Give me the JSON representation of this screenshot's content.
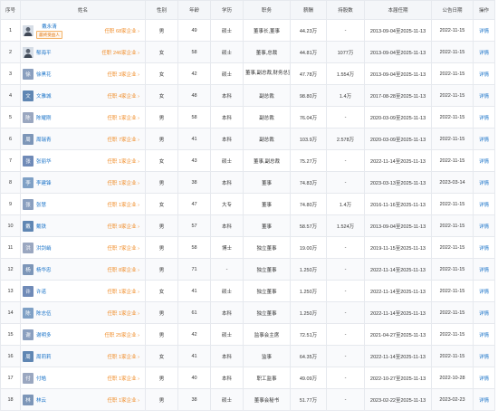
{
  "table": {
    "columns": [
      "序号",
      "姓名",
      "性别",
      "年龄",
      "学历",
      "职务",
      "薪酬",
      "持股数",
      "本届任期",
      "公告日期",
      "操作"
    ],
    "rows": [
      {
        "no": "1",
        "avatar": "photo",
        "name": "戴永清",
        "badge": "最终受益人",
        "companies": "任职 68家企业 ›",
        "gender": "男",
        "age": "49",
        "edu": "硕士",
        "title": "董事长,董事",
        "salary": "44.23万",
        "shares": "-",
        "term": "2013-09-04至2025-11-13",
        "date": "2022-11-15",
        "action": "详情"
      },
      {
        "no": "2",
        "avatar": "photo",
        "name": "郁海平",
        "badge": "",
        "companies": "任职 246家企业 ›",
        "gender": "女",
        "age": "58",
        "edu": "硕士",
        "title": "董事,总裁",
        "salary": "44.81万",
        "shares": "1077万",
        "term": "2013-09-04至2025-11-13",
        "date": "2022-11-15",
        "action": "详情"
      },
      {
        "no": "3",
        "avatar": "徐",
        "name": "徐黑花",
        "badge": "",
        "companies": "任职 3家企业 ›",
        "gender": "女",
        "age": "42",
        "edu": "硕士",
        "title": "董事,副总裁,财务总监",
        "salary": "47.78万",
        "shares": "1.554万",
        "term": "2013-09-04至2025-11-13",
        "date": "2022-11-15",
        "action": "详情"
      },
      {
        "no": "4",
        "avatar": "文",
        "name": "文雅城",
        "badge": "",
        "companies": "任职 4家企业 ›",
        "gender": "女",
        "age": "48",
        "edu": "本科",
        "title": "副总裁",
        "salary": "98.80万",
        "shares": "1.4万",
        "term": "2017-08-28至2025-11-13",
        "date": "2022-11-15",
        "action": "详情"
      },
      {
        "no": "5",
        "avatar": "陈",
        "name": "陈耀刚",
        "badge": "",
        "companies": "任职 1家企业 ›",
        "gender": "男",
        "age": "58",
        "edu": "本科",
        "title": "副总裁",
        "salary": "76.04万",
        "shares": "-",
        "term": "2020-03-09至2025-11-13",
        "date": "2022-11-15",
        "action": "详情"
      },
      {
        "no": "6",
        "avatar": "周",
        "name": "周瑞青",
        "badge": "",
        "companies": "任职 7家企业 ›",
        "gender": "男",
        "age": "41",
        "edu": "本科",
        "title": "副总裁",
        "salary": "103.9万",
        "shares": "2.578万",
        "term": "2020-03-09至2025-11-13",
        "date": "2022-11-15",
        "action": "详情"
      },
      {
        "no": "7",
        "avatar": "张",
        "name": "张丽华",
        "badge": "",
        "companies": "任职 1家企业 ›",
        "gender": "女",
        "age": "43",
        "edu": "硕士",
        "title": "董事,副总裁",
        "salary": "75.27万",
        "shares": "-",
        "term": "2022-11-14至2025-11-13",
        "date": "2022-11-15",
        "action": "详情"
      },
      {
        "no": "8",
        "avatar": "李",
        "name": "李建锋",
        "badge": "",
        "companies": "任职 1家企业 ›",
        "gender": "男",
        "age": "38",
        "edu": "本科",
        "title": "董事",
        "salary": "74.83万",
        "shares": "-",
        "term": "2023-03-13至2025-11-13",
        "date": "2023-03-14",
        "action": "详情"
      },
      {
        "no": "9",
        "avatar": "张",
        "name": "张慧",
        "badge": "",
        "companies": "任职 1家企业 ›",
        "gender": "女",
        "age": "47",
        "edu": "大专",
        "title": "董事",
        "salary": "74.80万",
        "shares": "1.4万",
        "term": "2016-11-16至2025-11-13",
        "date": "2022-11-15",
        "action": "详情"
      },
      {
        "no": "10",
        "avatar": "戴",
        "name": "戴铁",
        "badge": "",
        "companies": "任职 9家企业 ›",
        "gender": "男",
        "age": "57",
        "edu": "本科",
        "title": "董事",
        "salary": "58.57万",
        "shares": "1.524万",
        "term": "2013-09-04至2025-11-13",
        "date": "2022-11-15",
        "action": "详情"
      },
      {
        "no": "11",
        "avatar": "洪",
        "name": "洪剑峭",
        "badge": "",
        "companies": "任职 7家企业 ›",
        "gender": "男",
        "age": "58",
        "edu": "博士",
        "title": "独立董事",
        "salary": "19.00万",
        "shares": "-",
        "term": "2019-11-15至2025-11-13",
        "date": "2022-11-15",
        "action": "详情"
      },
      {
        "no": "12",
        "avatar": "杨",
        "name": "杨华忠",
        "badge": "",
        "companies": "任职 8家企业 ›",
        "gender": "男",
        "age": "71",
        "edu": "-",
        "title": "独立董事",
        "salary": "1.250万",
        "shares": "-",
        "term": "2022-11-14至2025-11-13",
        "date": "2022-11-15",
        "action": "详情"
      },
      {
        "no": "13",
        "avatar": "许",
        "name": "许诺",
        "badge": "",
        "companies": "任职 1家企业 ›",
        "gender": "女",
        "age": "41",
        "edu": "硕士",
        "title": "独立董事",
        "salary": "1.250万",
        "shares": "-",
        "term": "2022-11-14至2025-11-13",
        "date": "2022-11-15",
        "action": "详情"
      },
      {
        "no": "14",
        "avatar": "陈",
        "name": "陈志伍",
        "badge": "",
        "companies": "任职 1家企业 ›",
        "gender": "男",
        "age": "61",
        "edu": "本科",
        "title": "独立董事",
        "salary": "1.250万",
        "shares": "-",
        "term": "2022-11-14至2025-11-13",
        "date": "2022-11-15",
        "action": "详情"
      },
      {
        "no": "15",
        "avatar": "谢",
        "name": "谢明多",
        "badge": "",
        "companies": "任职 25家企业 ›",
        "gender": "男",
        "age": "42",
        "edu": "硕士",
        "title": "监事会主席",
        "salary": "72.51万",
        "shares": "-",
        "term": "2021-04-27至2025-11-13",
        "date": "2022-11-15",
        "action": "详情"
      },
      {
        "no": "16",
        "avatar": "周",
        "name": "周莉莉",
        "badge": "",
        "companies": "任职 1家企业 ›",
        "gender": "女",
        "age": "41",
        "edu": "本科",
        "title": "监事",
        "salary": "64.35万",
        "shares": "-",
        "term": "2022-11-14至2025-11-13",
        "date": "2022-11-15",
        "action": "详情"
      },
      {
        "no": "17",
        "avatar": "付",
        "name": "付皓",
        "badge": "",
        "companies": "任职 1家企业 ›",
        "gender": "男",
        "age": "40",
        "edu": "本科",
        "title": "职工监事",
        "salary": "49.09万",
        "shares": "-",
        "term": "2022-10-27至2025-11-13",
        "date": "2022-10-28",
        "action": "详情"
      },
      {
        "no": "18",
        "avatar": "林",
        "name": "林云",
        "badge": "",
        "companies": "任职 1家企业 ›",
        "gender": "男",
        "age": "38",
        "edu": "硕士",
        "title": "董事会秘书",
        "salary": "51.77万",
        "shares": "-",
        "term": "2023-02-22至2025-11-13",
        "date": "2023-02-23",
        "action": "详情"
      }
    ]
  },
  "colors": {
    "avatar_palette": [
      "#6f8ab7",
      "#7fa0c5",
      "#8a9fbf",
      "#5f86b3",
      "#9aa7c0",
      "#7d96b8"
    ],
    "link_blue": "#1a73c8",
    "company_orange": "#f08a24"
  }
}
